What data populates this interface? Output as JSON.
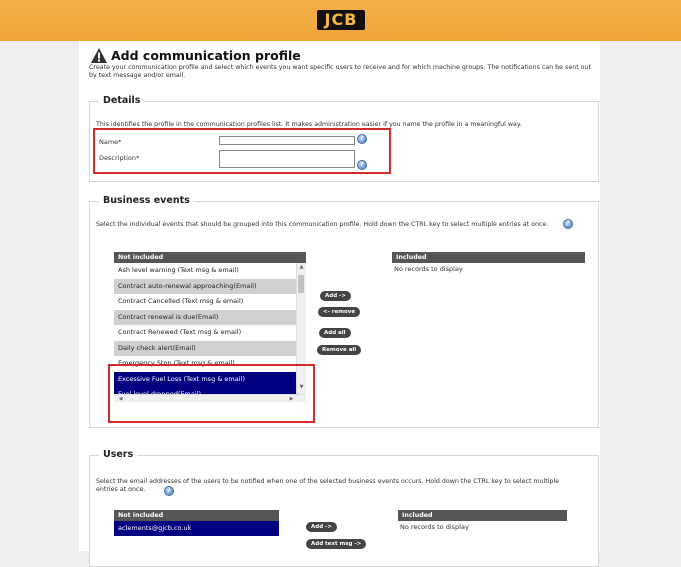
{
  "brand": {
    "logo": "JCB",
    "color": "#f0a438"
  },
  "page": {
    "title": "Add communication profile",
    "intro": "Create your communication profile and select which events you want specific users to receive and for which machine groups. The notifications can be sent out by text message and/or email."
  },
  "details": {
    "legend": "Details",
    "description": "This identifies the profile in the communication profiles list. It makes administration easier if you name the profile in a meaningful way.",
    "name_label": "Name*",
    "name_value": "",
    "description_label": "Description*",
    "description_value": ""
  },
  "business_events": {
    "legend": "Business events",
    "description": "Select the individual events that should be grouped into this communication profile. Hold down the CTRL key to select multiple entries at once.",
    "not_included_header": "Not included",
    "included_header": "Included",
    "no_records": "No records to display",
    "items": [
      {
        "label": "Ash level warning (Text msg & email)",
        "state": "normal"
      },
      {
        "label": "Contract auto-renewal approaching(Email)",
        "state": "alt"
      },
      {
        "label": "Contract Cancelled (Text msg & email)",
        "state": "normal"
      },
      {
        "label": "Contract renewal is due(Email)",
        "state": "alt"
      },
      {
        "label": "Contract Renewed (Text msg & email)",
        "state": "normal"
      },
      {
        "label": "Daily check alert(Email)",
        "state": "alt"
      },
      {
        "label": "Emergency Stop (Text msg & email)",
        "state": "normal"
      },
      {
        "label": "Excessive Fuel Loss (Text msg & email)",
        "state": "selected"
      },
      {
        "label": "Fuel level dropped(Email)",
        "state": "selected"
      }
    ],
    "buttons": {
      "add": "Add ->",
      "remove": "<- remove",
      "add_all": "Add all",
      "remove_all": "Remove all"
    }
  },
  "users": {
    "legend": "Users",
    "description": "Select the email addresses of the users to be notified when one of the selected business events occurs. Hold down the CTRL key to select multiple entries at once.",
    "not_included_header": "Not included",
    "included_header": "Included",
    "no_records": "No records to display",
    "items": [
      {
        "label": "aclements@gjcb.co.uk",
        "state": "selected"
      }
    ],
    "buttons": {
      "add": "Add ->",
      "add_text_msg": "Add text msg ->"
    }
  },
  "colors": {
    "selected": "#000080",
    "highlight_box": "#d12b2b",
    "list_header": "#555555"
  },
  "icons": {
    "title": "warning-icon",
    "help": "help-icon"
  }
}
